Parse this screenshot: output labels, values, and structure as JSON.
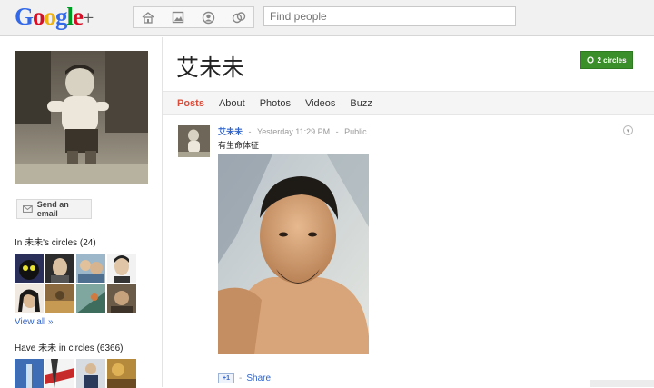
{
  "app": {
    "logo_letters": [
      {
        "ch": "G",
        "color": "#3369e8"
      },
      {
        "ch": "o",
        "color": "#d50f25"
      },
      {
        "ch": "o",
        "color": "#eeb211"
      },
      {
        "ch": "g",
        "color": "#3369e8"
      },
      {
        "ch": "l",
        "color": "#009925"
      },
      {
        "ch": "e",
        "color": "#d50f25"
      }
    ],
    "logo_plus": "+"
  },
  "topnav": {
    "icons": [
      "home-icon",
      "photos-icon",
      "profile-icon",
      "circles-icon"
    ],
    "search_placeholder": "Find people"
  },
  "sidebar": {
    "email_button": "Send an email",
    "in_circles_label": "In 未未's circles (24)",
    "view_all": "View all »",
    "have_in_circles_label": "Have 未未 in circles (6366)"
  },
  "profile": {
    "name": "艾未未",
    "circles_button": "2 circles",
    "tabs": [
      "Posts",
      "About",
      "Photos",
      "Videos",
      "Buzz"
    ],
    "active_tab": "Posts"
  },
  "post": {
    "author": "艾未未",
    "timestamp": "Yesterday 11:29 PM",
    "visibility": "Public",
    "separator": "-",
    "text": "有生命体征",
    "plus_one": "+1",
    "share": "Share"
  },
  "colors": {
    "accent_red": "#dd4b39",
    "link_blue": "#3366cc",
    "circles_green": "#3b8f2a"
  }
}
